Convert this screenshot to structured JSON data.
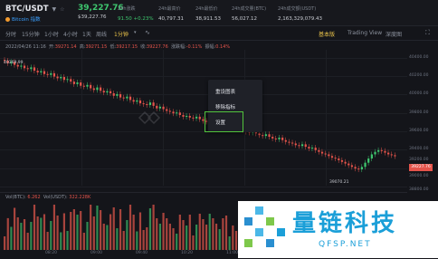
{
  "header": {
    "symbol": "BTC/USDT",
    "symbol_sub": "Bitcoin 指数",
    "last_price": "39,227.76",
    "last_price_usd": "$39,227.76",
    "stats": [
      {
        "label": "24h涨跌",
        "value": "91.50 +0.23%",
        "up": true
      },
      {
        "label": "24h最高价",
        "value": "40,797.31",
        "up": false
      },
      {
        "label": "24h最低价",
        "value": "38,911.53",
        "up": false
      },
      {
        "label": "24h成交量(BTC)",
        "value": "56,027.12",
        "up": false
      },
      {
        "label": "24h成交额(USDT)",
        "value": "2,163,329,079.43",
        "up": false
      }
    ]
  },
  "toolbar": {
    "timeframes": [
      {
        "label": "分时",
        "active": false
      },
      {
        "label": "15分钟",
        "active": false
      },
      {
        "label": "1小时",
        "active": false
      },
      {
        "label": "4小时",
        "active": false
      },
      {
        "label": "1天",
        "active": false
      },
      {
        "label": "周线",
        "active": false
      },
      {
        "label": "1分钟",
        "active": true
      }
    ],
    "views": [
      {
        "label": "基本版",
        "active": true
      },
      {
        "label": "Trading View",
        "active": false
      },
      {
        "label": "深度图",
        "active": false
      }
    ]
  },
  "ohlc": {
    "date": "2022/04/26 11:16",
    "open_label": "开:",
    "open": "39271.14",
    "high_label": "高:",
    "high": "39271.15",
    "low_label": "低:",
    "low": "39217.15",
    "close_label": "收:",
    "close": "39227.76",
    "change_label": "涨跌幅:",
    "change": "-0.11%",
    "amp_label": "振幅:",
    "amp": "0.14%"
  },
  "high_marker": "40369.99",
  "low_marker": "39070.21",
  "price_axis": [
    "40400.00",
    "40200.00",
    "40000.00",
    "39800.00",
    "39600.00",
    "39400.00",
    "39200.00",
    "39000.00",
    "38800.00"
  ],
  "current_price_badge": "39227.76",
  "context_menu": {
    "items": [
      "重设图表",
      "移除指标",
      "设置"
    ],
    "highlighted": "设置"
  },
  "volume": {
    "label": "Vol(BTC):",
    "btc": "6.262",
    "label2": "Vol(USDT):",
    "usdt": "322.228K"
  },
  "time_axis": [
    "08:20",
    "09:00",
    "09:40",
    "10:20",
    "11:00"
  ],
  "watermark": {
    "text": "量链科技",
    "url": "QFSP.NET"
  },
  "chart_data": {
    "type": "candlestick",
    "closes": [
      40369,
      40340,
      40355,
      40320,
      40300,
      40310,
      40280,
      40270,
      40290,
      40250,
      40230,
      40245,
      40210,
      40200,
      40220,
      40180,
      40160,
      40175,
      40140,
      40150,
      40120,
      40090,
      40110,
      40070,
      40060,
      40080,
      40040,
      40020,
      40050,
      40010,
      39990,
      40005,
      39980,
      39950,
      39970,
      39930,
      39920,
      39940,
      39900,
      39880,
      39895,
      39860,
      39850,
      39840,
      39870,
      39830,
      39800,
      39820,
      39790,
      39770,
      39760,
      39740,
      39750,
      39720,
      39700,
      39710,
      39690,
      39680,
      39700,
      39670,
      39650,
      39640,
      39660,
      39630,
      39610,
      39620,
      39600,
      39580,
      39590,
      39570,
      39560,
      39580,
      39540,
      39520,
      39510,
      39530,
      39500,
      39480,
      39470,
      39490,
      39460,
      39440,
      39430,
      39450,
      39420,
      39400,
      39390,
      39380,
      39360,
      39350,
      39370,
      39340,
      39320,
      39330,
      39300,
      39280,
      39260,
      39250,
      39230,
      39210,
      39200,
      39180,
      39160,
      39140,
      39120,
      39100,
      39080,
      39070,
      39100,
      39150,
      39200,
      39250,
      39280,
      39300,
      39290,
      39270,
      39250,
      39240,
      39227
    ],
    "ylim": [
      38800,
      40500
    ]
  }
}
